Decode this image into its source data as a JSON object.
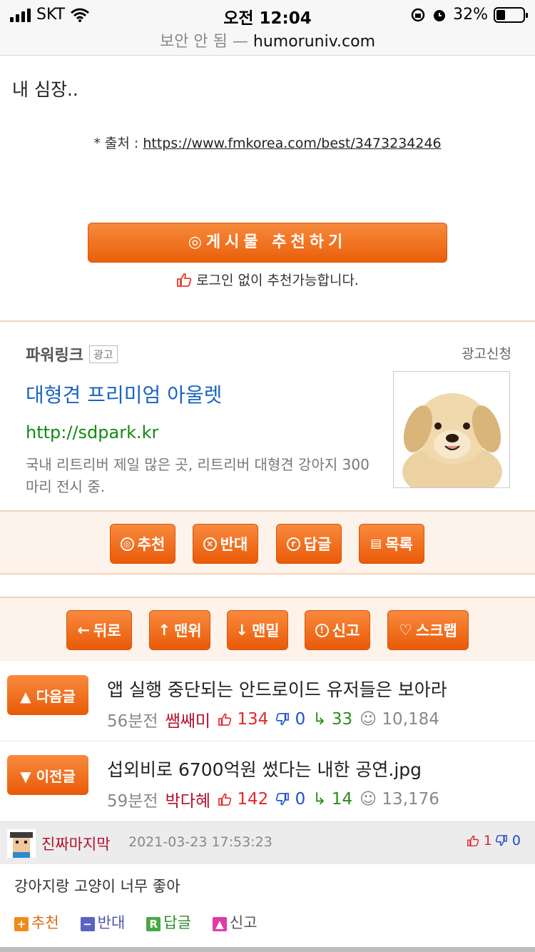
{
  "status_bar": {
    "carrier": "SKT",
    "time": "오전 12:04",
    "battery": "32%",
    "battery_level": 0.32,
    "url_insecure": "보안 안 됨 —",
    "url_domain": "humoruniv.com"
  },
  "post": {
    "text": "내 심장..",
    "source_label": "* 출처 : ",
    "source_url": "https://www.fmkorea.com/best/3473234246",
    "recommend_button": "◎게시물  추천하기",
    "recommend_note": "로그인 없이 추천가능합니다."
  },
  "ad": {
    "header": "파워링크",
    "badge": "광고",
    "apply": "광고신청",
    "title": "대형견 프리미엄 아울렛",
    "url": "http://sdpark.kr",
    "desc": "국내 리트리버 제일 많은 곳, 리트리버 대형견 강아지 300마리 전시 중."
  },
  "toolbar1": [
    {
      "icon": "◎",
      "label": "추천"
    },
    {
      "icon": "ⓧ",
      "label": "반대"
    },
    {
      "icon": "ⓡ",
      "label": "답글"
    },
    {
      "icon": "▤",
      "label": "목록"
    }
  ],
  "toolbar2": [
    {
      "icon": "←",
      "label": "뒤로"
    },
    {
      "icon": "↑",
      "label": "맨위"
    },
    {
      "icon": "↓",
      "label": "맨밑"
    },
    {
      "icon": "⚠",
      "label": "신고"
    },
    {
      "icon": "♡",
      "label": "스크랩"
    }
  ],
  "next_post": {
    "button": "▲ 다음글",
    "title": "앱 실행 중단되는 안드로이드 유저들은 보아라",
    "time": "56분전",
    "author": "쌤쌔미",
    "up": "134",
    "down": "0",
    "replies": "33",
    "views": "10,184"
  },
  "prev_post": {
    "button": "▼ 이전글",
    "title": "섭외비로 6700억원 썼다는 내한 공연.jpg",
    "time": "59분전",
    "author": "박다혜",
    "up": "142",
    "down": "0",
    "replies": "14",
    "views": "13,176"
  },
  "comment": {
    "author": "진짜마지막",
    "date": "2021-03-23 17:53:23",
    "up": "1",
    "down": "0",
    "body": "강아지랑 고양이 너무 좋아",
    "actions": {
      "recommend": "추천",
      "oppose": "반대",
      "reply": "답글",
      "report": "신고"
    }
  },
  "colors": {
    "accent_orange": "#ea5f09",
    "link_blue": "#1a64c0",
    "ad_green": "#138913",
    "author_red": "#b3102a"
  }
}
